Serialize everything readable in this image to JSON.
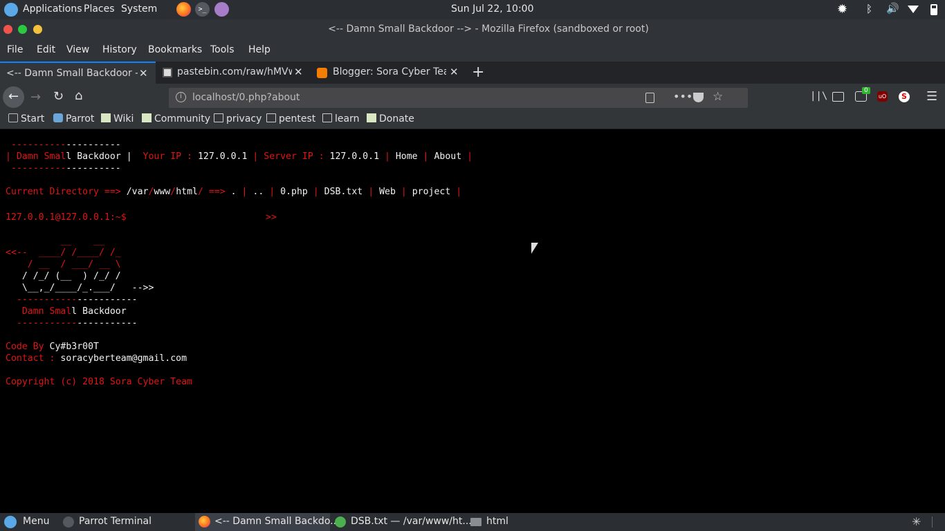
{
  "top_panel": {
    "menus": [
      "Applications",
      "Places",
      "System"
    ],
    "clock": "Sun Jul 22, 10:00"
  },
  "window": {
    "title": "<-- Damn Small Backdoor --> - Mozilla Firefox (sandboxed or root)"
  },
  "menubar": [
    "File",
    "Edit",
    "View",
    "History",
    "Bookmarks",
    "Tools",
    "Help"
  ],
  "tabs": [
    {
      "label": "<-- Damn Small Backdoor -->"
    },
    {
      "label": "pastebin.com/raw/hMVwQ"
    },
    {
      "label": "Blogger: Sora Cyber Team"
    }
  ],
  "urlbar": {
    "url": "localhost/0.php?about",
    "badge_count": "0"
  },
  "bookmarks": [
    "Start",
    "Parrot",
    "Wiki",
    "Community",
    "privacy",
    "pentest",
    "learn",
    "Donate"
  ],
  "page": {
    "header_dashes_red": " ----------",
    "header_dashes_white": "----------",
    "app_name_red": "Damn Smal",
    "app_name_white": "l Backdoor",
    "your_ip_label": "Your IP :",
    "your_ip": "127.0.0.1",
    "server_ip_label": "Server IP :",
    "server_ip": "127.0.0.1",
    "nav_home": "Home",
    "nav_about": "About",
    "current_dir_label": "Current Directory ==>",
    "dir_parts": [
      "/var",
      "/",
      "www",
      "/",
      "html",
      "/"
    ],
    "dir_arrow": "==>",
    "files": [
      ".",
      "..",
      "0.php",
      "DSB.txt",
      "Web",
      "project"
    ],
    "prompt": "127.0.0.1@127.0.0.1:~$",
    "prompt_arrow": ">>",
    "ascii_line1": "          __    __",
    "ascii_line2_prefix": "<<--  ",
    "ascii_line2": "____/ /____/ /_",
    "ascii_line3": "    / __  / ___/ __ \\",
    "ascii_line4": "   / /_/ (__  ) /_/ /",
    "ascii_line5": "   \\__,_/____/_.___/",
    "ascii_arrow": "-->>",
    "ascii_dashes_red": "  -----------",
    "ascii_dashes_white": "-----------",
    "ascii_name_red": "   Damn Smal",
    "ascii_name_white": "l Backdoor",
    "code_by_label": "Code By",
    "code_by": "Cy#b3r00T",
    "contact_label": "Contact :",
    "contact": "soracyberteam@gmail.com",
    "copyright": "Copyright (c) 2018 Sora Cyber Team"
  },
  "taskbar": {
    "menu": "Menu",
    "items": [
      "Parrot Terminal",
      "<-- Damn Small Backdo...",
      "DSB.txt — /var/www/ht...",
      "html"
    ]
  },
  "colors": {
    "accent_red": "#e01414",
    "tab_accent": "#0a84ff",
    "panel": "#2b2e33"
  }
}
